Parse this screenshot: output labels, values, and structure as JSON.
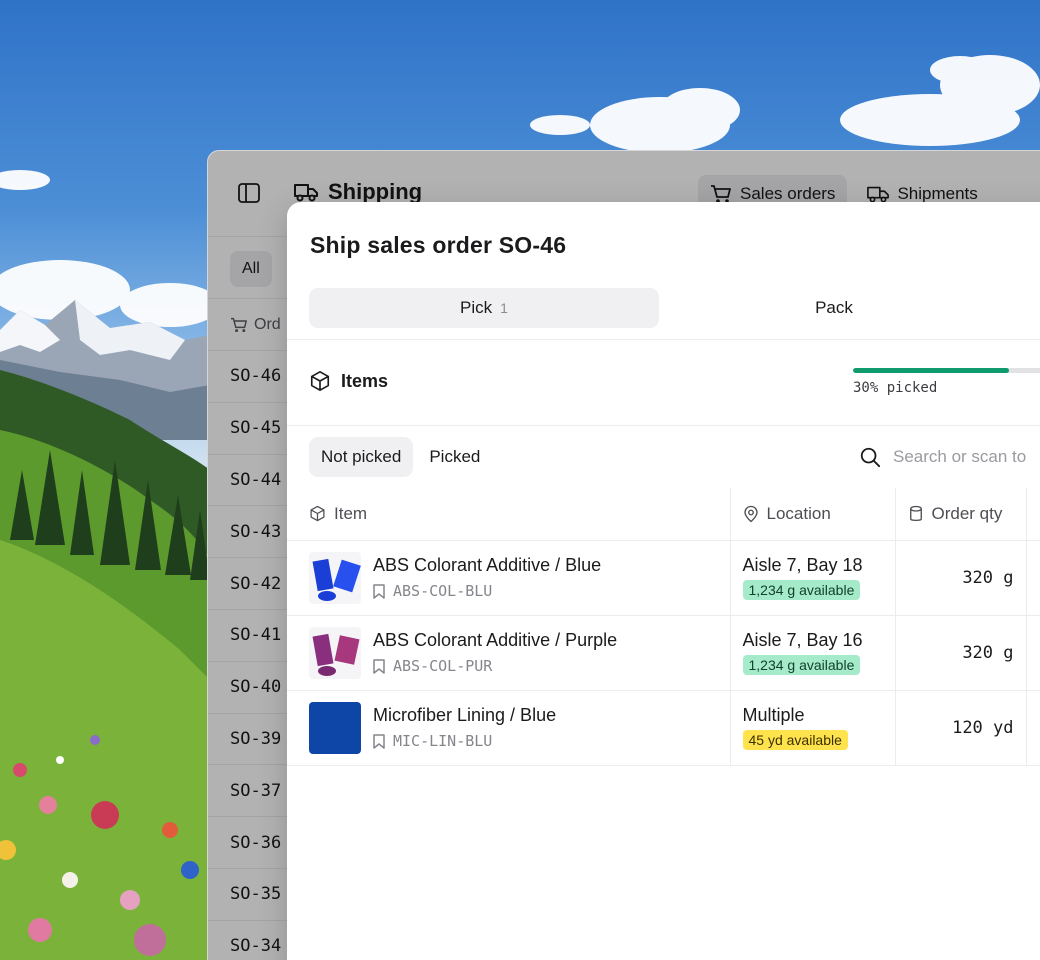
{
  "app": {
    "title": "Shipping",
    "header_tabs": [
      {
        "label": "Sales orders",
        "active": true,
        "icon": "cart-icon"
      },
      {
        "label": "Shipments",
        "active": false,
        "icon": "truck-icon"
      }
    ],
    "filter_all": "All",
    "orders_column": "Ord",
    "orders": [
      "SO-46",
      "SO-45",
      "SO-44",
      "SO-43",
      "SO-42",
      "SO-41",
      "SO-40",
      "SO-39",
      "SO-37",
      "SO-36",
      "SO-35",
      "SO-34"
    ]
  },
  "modal": {
    "title": "Ship sales order SO-46",
    "segments": [
      {
        "label": "Pick",
        "count": "1",
        "active": true
      },
      {
        "label": "Pack",
        "count": "",
        "active": false
      }
    ],
    "items_heading": "Items",
    "progress": {
      "fraction": 0.65,
      "label": "30% picked",
      "color": "#0f9b6e"
    },
    "subtabs": [
      {
        "label": "Not picked",
        "active": true
      },
      {
        "label": "Picked",
        "active": false
      }
    ],
    "search_placeholder": "Search or scan to",
    "columns": {
      "item": "Item",
      "location": "Location",
      "order_qty": "Order qty"
    },
    "rows": [
      {
        "name": "ABS Colorant Additive / Blue",
        "sku": "ABS-COL-BLU",
        "location": "Aisle 7, Bay 18",
        "availability": "1,234 g available",
        "badge_color": "#a6ebc9",
        "qty": "320 g",
        "thumb_color": "#1b3fd6"
      },
      {
        "name": "ABS Colorant Additive / Purple",
        "sku": "ABS-COL-PUR",
        "location": "Aisle 7, Bay 16",
        "availability": "1,234 g available",
        "badge_color": "#a6ebc9",
        "qty": "320 g",
        "thumb_color": "#8a2f7e"
      },
      {
        "name": "Microfiber Lining / Blue",
        "sku": "MIC-LIN-BLU",
        "location": "Multiple",
        "availability": "45 yd available",
        "badge_color": "#ffe34d",
        "qty": "120 yd",
        "thumb_color": "#0e46a8"
      }
    ]
  }
}
